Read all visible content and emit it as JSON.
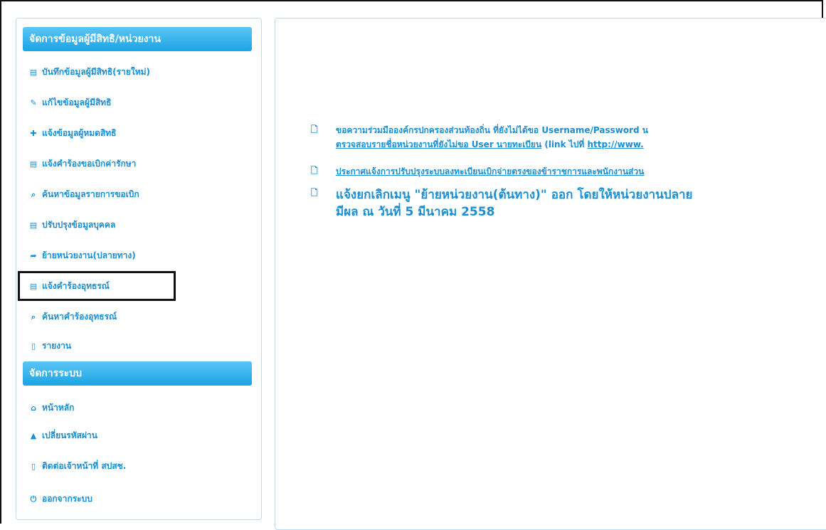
{
  "sidebar": {
    "section1": "จัดการข้อมูลผู้มีสิทธิ/หน่วยงาน",
    "items1": [
      {
        "icon": "▤",
        "label": "บันทึกข้อมูลผู้มีสิทธิ(รายใหม่)"
      },
      {
        "icon": "✎",
        "label": "แก้ไขข้อมูลผู้มีสิทธิ"
      },
      {
        "icon": "✚",
        "label": "แจ้งข้อมูลผู้หมดสิทธิ"
      },
      {
        "icon": "▤",
        "label": "แจ้งคำร้องขอเบิกค่ารักษา"
      },
      {
        "icon": "⌕",
        "label": "ค้นหาข้อมูลรายการขอเบิก"
      },
      {
        "icon": "▤",
        "label": "ปรับปรุงข้อมูลบุคคล"
      },
      {
        "icon": "➦",
        "label": "ย้ายหน่วยงาน(ปลายทาง)"
      },
      {
        "icon": "▤",
        "label": "แจ้งคำร้องอุทธรณ์"
      },
      {
        "icon": "⌕",
        "label": "ค้นหาคำร้องอุทธรณ์"
      },
      {
        "icon": "▯",
        "label": "รายงาน"
      }
    ],
    "section2": "จัดการระบบ",
    "items2": [
      {
        "icon": "⌂",
        "label": "หน้าหลัก"
      },
      {
        "icon": "▲",
        "label": "เปลี่ยนรหัสผ่าน"
      },
      {
        "icon": "▯",
        "label": "ติดต่อเจ้าหน้าที่ สปสช."
      },
      {
        "icon": "⏻",
        "label": "ออกจากระบบ"
      }
    ]
  },
  "news": {
    "bullet": "🗋",
    "item1_line1": "ขอความร่วมมือองค์กรปกครองส่วนท้องถิ่น ที่ยังไม่ได้ขอ Username/Password น",
    "item1_line2_link": "ตรวจสอบรายชื่อหน่วยงานที่ยังไม่ขอ User นายทะเบียน",
    "item1_line2_mid": " (link ไปที่ ",
    "item1_line2_url": "http://www.",
    "item2": "ประกาศแจ้งการปรับปรุงระบบลงทะเบียนเบิกจ่ายตรงของข้าราชการและพนักงานส่วน",
    "item3_line1": "แจ้งยกเลิกเมนู \"ย้ายหน่วยงาน(ต้นทาง)\" ออก โดยให้หน่วยงานปลาย",
    "item3_line2": "มีผล ณ วันที่ 5 มีนาคม 2558"
  }
}
